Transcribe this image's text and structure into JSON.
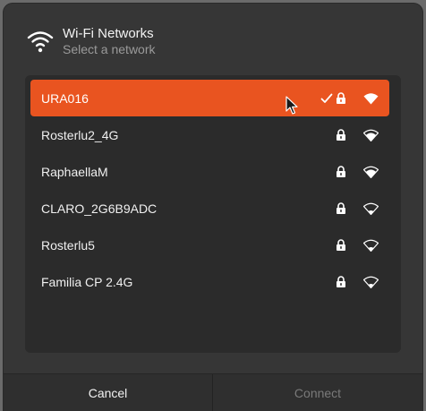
{
  "dialog": {
    "title": "Wi-Fi Networks",
    "subtitle": "Select a network",
    "header_icon": "wifi-icon"
  },
  "networks": [
    {
      "ssid": "URA016",
      "selected": true,
      "connected": true,
      "secured": true,
      "signal": "full"
    },
    {
      "ssid": "Rosterlu2_4G",
      "selected": false,
      "connected": false,
      "secured": true,
      "signal": "good"
    },
    {
      "ssid": "RaphaellaM",
      "selected": false,
      "connected": false,
      "secured": true,
      "signal": "good"
    },
    {
      "ssid": "CLARO_2G6B9ADC",
      "selected": false,
      "connected": false,
      "secured": true,
      "signal": "weak"
    },
    {
      "ssid": "Rosterlu5",
      "selected": false,
      "connected": false,
      "secured": true,
      "signal": "weak"
    },
    {
      "ssid": "Familia CP 2.4G",
      "selected": false,
      "connected": false,
      "secured": true,
      "signal": "weak"
    }
  ],
  "footer": {
    "cancel_label": "Cancel",
    "connect_label": "Connect",
    "connect_enabled": false
  },
  "colors": {
    "accent": "#e95420",
    "dialog_bg": "#363636",
    "list_bg": "#2b2b2b"
  }
}
